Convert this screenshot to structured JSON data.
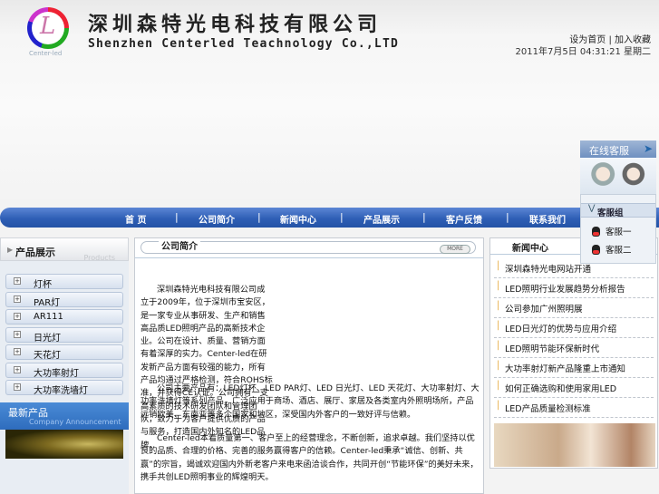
{
  "header": {
    "logo_letter": "L",
    "logo_sub": "Center-led",
    "company_cn": "深圳森特光电科技有限公司",
    "company_en": "Shenzhen Centerled Teachnology Co.,LTD",
    "links": [
      "设为首页",
      "加入收藏"
    ],
    "link_sep": "|",
    "datetime": "2011年7月5日 04:31:21 星期二"
  },
  "nav": {
    "items": [
      "首 页",
      "公司简介",
      "新闻中心",
      "产品展示",
      "客户反馈",
      "联系我们"
    ],
    "sep": "|"
  },
  "left": {
    "products_title": "产品展示",
    "products_en": "Products",
    "products": [
      "灯杯",
      "PAR灯",
      "AR111",
      "日光灯",
      "天花灯",
      "大功率射灯",
      "大功率洗墙灯"
    ],
    "new_title": "最新产品",
    "new_en": "Company Announcement"
  },
  "center": {
    "title": "公司简介",
    "more": "MORE",
    "paragraphs": [
      "深圳森特光电科技有限公司成立于2009年，位于深圳市宝安区，是一家专业从事研发、生产和销售高品质LED照明产品的高新技术企业。公司在设计、质量、营销方面有着深厚的实力。Center-led在研发新产品方面有较强的能力，所有产品均通过严格检测，符合ROHS标准，并获得CE认证。公司拥有一支高素质的技术研发团队和管理团队，致力于为客户提供优质的产品与服务，打造国内外知名的LED品牌。",
      "公司主要产品有：LED灯杯、LED PAR灯、LED 日光灯、LED 天花灯、大功率射灯、大功率洗墙灯等系列产品，广泛应用于商场、酒店、展厅、家居及各类室内外照明场所，产品远销欧美、东南亚等多个国家和地区，深受国内外客户的一致好评与信赖。",
      "Center-led本着质量第一、客户至上的经营理念，不断创新，追求卓越。我们坚持以优良的品质、合理的价格、完善的服务赢得客户的信赖。Center-led秉承“诚信、创新、共赢”的宗旨，竭诚欢迎国内外新老客户来电来函洽谈合作，共同开创“节能环保”的美好未来，携手共创LED照明事业的辉煌明天。"
    ]
  },
  "news": {
    "title": "新闻中心",
    "items": [
      "深圳森特光电网站开通",
      "LED照明行业发展趋势分析报告",
      "公司参加广州照明展",
      "LED日光灯的优势与应用介绍",
      "LED照明节能环保新时代",
      "大功率射灯新产品隆重上市通知",
      "如何正确选购和使用家用LED",
      "LED产品质量检测标准"
    ]
  },
  "service": {
    "title": "在线客服",
    "group": "客服组",
    "agents": [
      "客服一",
      "客服二"
    ]
  }
}
